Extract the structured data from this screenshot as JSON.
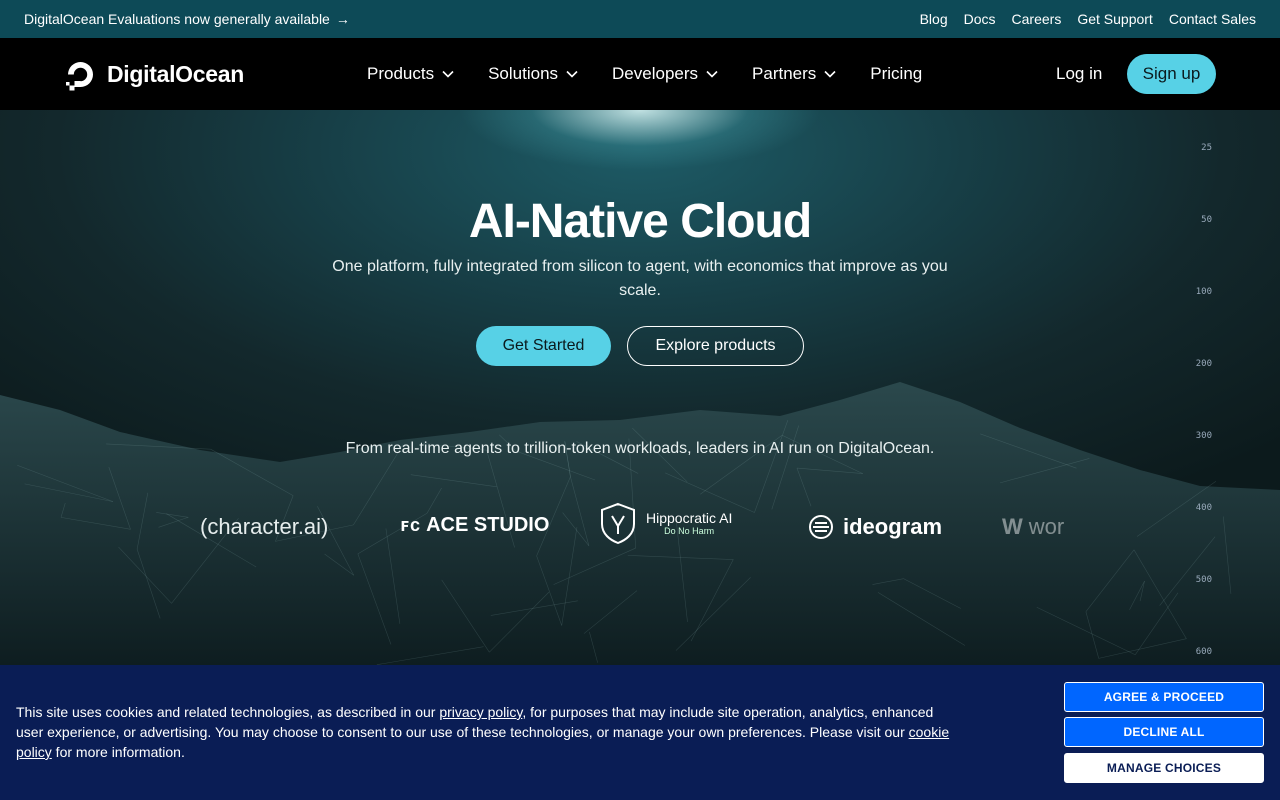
{
  "announcement": {
    "text": "DigitalOcean Evaluations now generally available",
    "arrow": "→",
    "links": [
      "Blog",
      "Docs",
      "Careers",
      "Get Support",
      "Contact Sales"
    ]
  },
  "nav": {
    "brand": "DigitalOcean",
    "menu": [
      {
        "label": "Products",
        "has_dropdown": true
      },
      {
        "label": "Solutions",
        "has_dropdown": true
      },
      {
        "label": "Developers",
        "has_dropdown": true
      },
      {
        "label": "Partners",
        "has_dropdown": true
      },
      {
        "label": "Pricing",
        "has_dropdown": false
      }
    ],
    "login": "Log in",
    "signup": "Sign up"
  },
  "hero": {
    "title": "AI-Native Cloud",
    "subtitle": "One platform, fully integrated from silicon to agent, with economics that improve as you scale.",
    "primary_cta": "Get Started",
    "secondary_cta": "Explore products",
    "tagline": "From real-time agents to trillion-token workloads, leaders in AI run on DigitalOcean.",
    "customer_logos": [
      {
        "name": "(character.ai)"
      },
      {
        "name": "ACE STUDIO",
        "mark": "ꜰc"
      },
      {
        "name": "Hippocratic AI",
        "sub": "Do No Harm"
      },
      {
        "name": "ideogram"
      },
      {
        "name": "wor"
      }
    ],
    "scale_labels": [
      "25",
      "50",
      "100",
      "200",
      "300",
      "400",
      "500",
      "600"
    ]
  },
  "cookie_banner": {
    "text_1": "This site uses cookies and related technologies, as described in our ",
    "privacy_link": "privacy policy",
    "text_2": ", for purposes that may include site operation, analytics, enhanced user experience, or advertising. You may choose to consent to our use of these technologies, or manage your own preferences. Please visit our ",
    "cookie_link": "cookie policy",
    "text_3": " for more information.",
    "agree": "AGREE & PROCEED",
    "decline": "DECLINE ALL",
    "manage": "MANAGE CHOICES"
  },
  "colors": {
    "accent": "#57d1e6",
    "announcement_bg": "#0d4a57",
    "cookie_bg": "#0a1d55",
    "cookie_button_blue": "#0066ff"
  }
}
